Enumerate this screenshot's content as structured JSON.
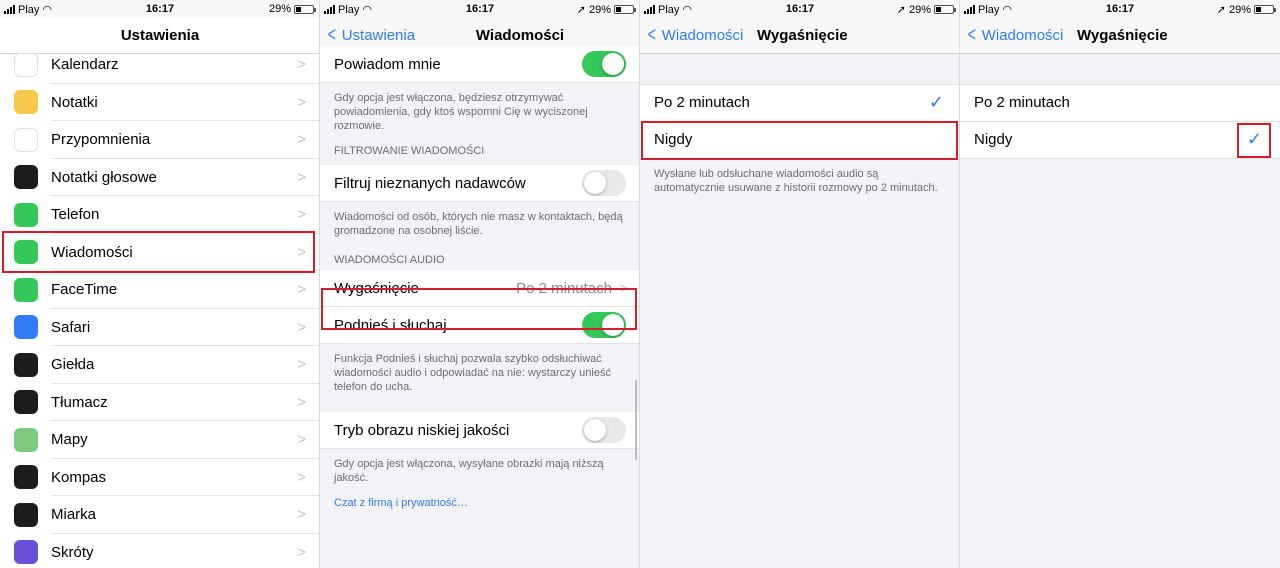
{
  "status": {
    "carrier": "Play",
    "time": "16:17",
    "battery": "29%"
  },
  "panel1": {
    "title": "Ustawienia",
    "items": [
      {
        "label": "Kalendarz",
        "icon": "calendar-icon",
        "color": "#ffffff"
      },
      {
        "label": "Notatki",
        "icon": "notes-icon",
        "color": "#f7c84a"
      },
      {
        "label": "Przypomnienia",
        "icon": "reminders-icon",
        "color": "#ffffff"
      },
      {
        "label": "Notatki głosowe",
        "icon": "voice-memos-icon",
        "color": "#1c1c1e"
      },
      {
        "label": "Telefon",
        "icon": "phone-icon",
        "color": "#34c759"
      },
      {
        "label": "Wiadomości",
        "icon": "messages-icon",
        "color": "#34c759"
      },
      {
        "label": "FaceTime",
        "icon": "facetime-icon",
        "color": "#34c759"
      },
      {
        "label": "Safari",
        "icon": "safari-icon",
        "color": "#2f7cf6"
      },
      {
        "label": "Giełda",
        "icon": "stocks-icon",
        "color": "#1c1c1e"
      },
      {
        "label": "Tłumacz",
        "icon": "translate-icon",
        "color": "#1c1c1e"
      },
      {
        "label": "Mapy",
        "icon": "maps-icon",
        "color": "#7fc97f"
      },
      {
        "label": "Kompas",
        "icon": "compass-icon",
        "color": "#1c1c1e"
      },
      {
        "label": "Miarka",
        "icon": "measure-icon",
        "color": "#1c1c1e"
      },
      {
        "label": "Skróty",
        "icon": "shortcuts-icon",
        "color": "#6b4fd8"
      }
    ]
  },
  "panel2": {
    "back": "Ustawienia",
    "title": "Wiadomości",
    "notify_label": "Powiadom mnie",
    "notify_foot": "Gdy opcja jest włączona, będziesz otrzymywać powiadomienia, gdy ktoś wspomni Cię w wyciszonej rozmowie.",
    "filter_header": "FILTROWANIE WIADOMOŚCI",
    "filter_label": "Filtruj nieznanych nadawców",
    "filter_foot": "Wiadomości od osób, których nie masz w kontaktach, będą gromadzone na osobnej liście.",
    "audio_header": "WIADOMOŚCI AUDIO",
    "expire_label": "Wygaśnięcie",
    "expire_value": "Po 2 minutach",
    "raise_label": "Podnieś i słuchaj",
    "raise_foot": "Funkcja Podnieś i słuchaj pozwala szybko odsłuchiwać wiadomości audio i odpowiadać na nie: wystarczy unieść telefon do ucha.",
    "lowq_label": "Tryb obrazu niskiej jakości",
    "lowq_foot": "Gdy opcja jest włączona, wysyłane obrazki mają niższą jakość.",
    "privacy_link": "Czat z firmą i prywatność…"
  },
  "panel3": {
    "back": "Wiadomości",
    "title": "Wygaśnięcie",
    "option1": "Po 2 minutach",
    "option2": "Nigdy",
    "foot": "Wysłane lub odsłuchane wiadomości audio są automatycznie usuwane z historii rozmowy po 2 minutach."
  },
  "panel4": {
    "back": "Wiadomości",
    "title": "Wygaśnięcie",
    "option1": "Po 2 minutach",
    "option2": "Nigdy"
  },
  "colors": {
    "accent": "#2f7cf6",
    "highlight": "#d31f2b",
    "toggle_on": "#34c759"
  }
}
